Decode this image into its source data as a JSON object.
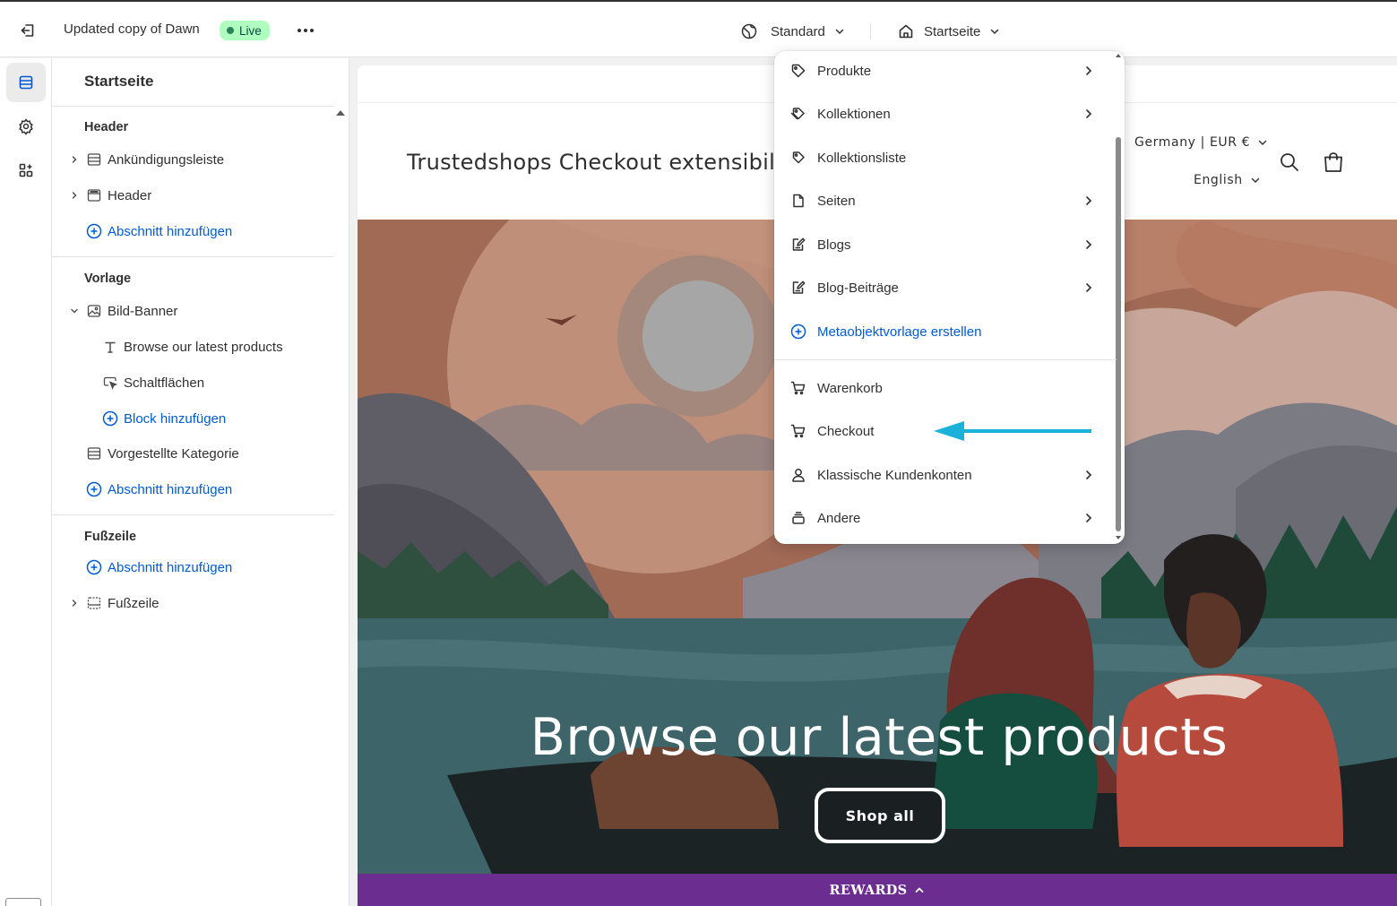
{
  "topbar": {
    "theme_name": "Updated copy of Dawn",
    "live_label": "Live",
    "view_select": "Standard",
    "page_select": "Startseite"
  },
  "sidebar": {
    "title": "Startseite",
    "groups": {
      "header": {
        "title": "Header",
        "items": [
          "Ankündigungsleiste",
          "Header"
        ],
        "add_label": "Abschnitt hinzufügen"
      },
      "template": {
        "title": "Vorlage",
        "banner": "Bild-Banner",
        "blocks": [
          "Browse our latest products",
          "Schaltflächen"
        ],
        "add_block_label": "Block hinzufügen",
        "featured": "Vorgestellte Kategorie",
        "add_label": "Abschnitt hinzufügen"
      },
      "footer": {
        "title": "Fußzeile",
        "add_label": "Abschnitt hinzufügen",
        "items": [
          "Fußzeile"
        ]
      }
    }
  },
  "dropdown": {
    "items": [
      {
        "label": "Produkte",
        "icon": "tag-icon",
        "has_submenu": true
      },
      {
        "label": "Kollektionen",
        "icon": "tags-icon",
        "has_submenu": true
      },
      {
        "label": "Kollektionsliste",
        "icon": "tags-icon",
        "has_submenu": false
      },
      {
        "label": "Seiten",
        "icon": "page-icon",
        "has_submenu": true
      },
      {
        "label": "Blogs",
        "icon": "blog-icon",
        "has_submenu": true
      },
      {
        "label": "Blog-Beiträge",
        "icon": "blog-icon",
        "has_submenu": true
      },
      {
        "label": "Metaobjektvorlage erstellen",
        "icon": "plus-circle-icon",
        "has_submenu": false
      },
      {
        "label": "Warenkorb",
        "icon": "cart-icon",
        "has_submenu": false
      },
      {
        "label": "Checkout",
        "icon": "cart-icon",
        "has_submenu": false
      },
      {
        "label": "Klassische Kundenkonten",
        "icon": "person-icon",
        "has_submenu": true
      },
      {
        "label": "Andere",
        "icon": "stack-icon",
        "has_submenu": true
      }
    ]
  },
  "preview": {
    "store_name": "Trustedshops Checkout extensibili",
    "country_currency": "Germany | EUR €",
    "language": "English",
    "banner_heading": "Browse our latest products",
    "banner_button": "Shop all",
    "rewards_label": "REWARDS"
  },
  "colors": {
    "accent_link": "#005bd3",
    "live_badge": "#affebf",
    "annotation_arrow": "#1ab2d8",
    "rewards_bar": "#6b2d8f"
  }
}
